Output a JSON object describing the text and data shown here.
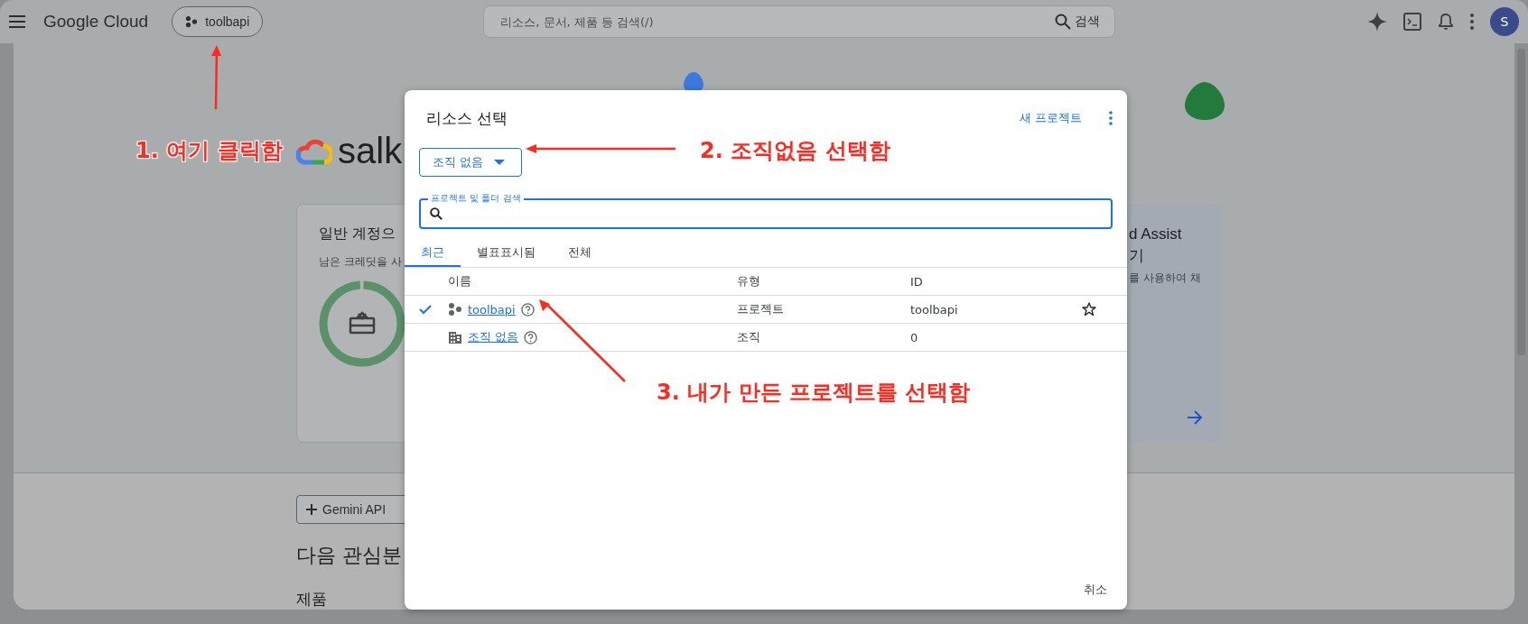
{
  "topbar": {
    "product": "Google Cloud",
    "project_chip": "toolbapi",
    "search": {
      "placeholder": "리소스, 문서, 제품 등 검색(/)",
      "button": "검색"
    },
    "avatar": "S"
  },
  "page": {
    "project_name": "salk",
    "credit_card": {
      "title": "일반 계정으",
      "subtitle": "남은 크레딧을 사"
    },
    "assist_card": {
      "title_lines": [
        "d Assist",
        "기"
      ],
      "text": "를 사용하여 채"
    },
    "gemini_button": "Gemini API",
    "heading": "다음 관심분",
    "section": "제품"
  },
  "dialog": {
    "title": "리소스 선택",
    "new_project": "새 프로젝트",
    "org_dropdown": "조직 없음",
    "search": {
      "label": "프로젝트 및 폴더 검색"
    },
    "tabs": [
      {
        "label": "최근",
        "selected": true
      },
      {
        "label": "별표표시됨",
        "selected": false
      },
      {
        "label": "전체",
        "selected": false
      }
    ],
    "columns": [
      "이름",
      "유형",
      "ID"
    ],
    "rows": [
      {
        "kind": "project",
        "name": "toolbapi",
        "type": "프로젝트",
        "id": "toolbapi",
        "selected": true
      },
      {
        "kind": "organization",
        "name": "조직 없음",
        "type": "조직",
        "id": "0",
        "selected": false
      }
    ],
    "cancel": "취소"
  },
  "annotations": [
    "1. 여기 클릭함",
    "2. 조직없음 선택함",
    "3. 내가 만든 프로젝트를 선택함"
  ]
}
